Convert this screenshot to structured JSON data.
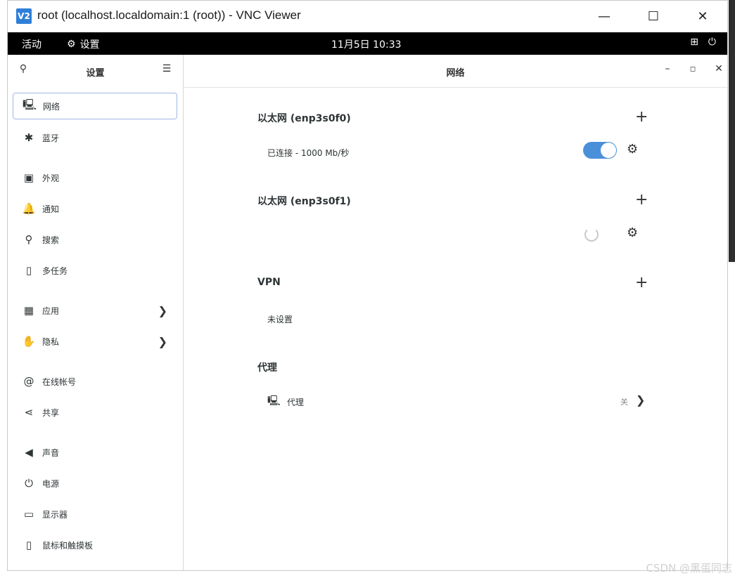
{
  "window": {
    "title": "root (localhost.localdomain:1 (root)) - VNC Viewer",
    "logo": "V2",
    "minimize": "—",
    "maximize": "☐",
    "close": "✕"
  },
  "topbar": {
    "activities": "活动",
    "app_menu": "设置",
    "clock": "11月5日  10:33"
  },
  "sidebar": {
    "title": "设置",
    "items": [
      {
        "label": "网络",
        "icon": "network-icon",
        "glyph": "🖳",
        "chevron": false
      },
      {
        "label": "蓝牙",
        "icon": "bluetooth-icon",
        "glyph": "✱",
        "chevron": false
      },
      {
        "label": "外观",
        "icon": "appearance-icon",
        "glyph": "▣",
        "chevron": false
      },
      {
        "label": "通知",
        "icon": "bell-icon",
        "glyph": "🔔",
        "chevron": false
      },
      {
        "label": "搜索",
        "icon": "search-icon",
        "glyph": "⚲",
        "chevron": false
      },
      {
        "label": "多任务",
        "icon": "multitask-icon",
        "glyph": "▯",
        "chevron": false
      },
      {
        "label": "应用",
        "icon": "apps-icon",
        "glyph": "▦",
        "chevron": true
      },
      {
        "label": "隐私",
        "icon": "hand-icon",
        "glyph": "✋",
        "chevron": true
      },
      {
        "label": "在线帐号",
        "icon": "at-icon",
        "glyph": "@",
        "chevron": false
      },
      {
        "label": "共享",
        "icon": "share-icon",
        "glyph": "⋖",
        "chevron": false
      },
      {
        "label": "声音",
        "icon": "speaker-icon",
        "glyph": "◀",
        "chevron": false
      },
      {
        "label": "电源",
        "icon": "power-plug-icon",
        "glyph": "⏻",
        "chevron": false
      },
      {
        "label": "显示器",
        "icon": "display-icon",
        "glyph": "▭",
        "chevron": false
      },
      {
        "label": "鼠标和触摸板",
        "icon": "mouse-icon",
        "glyph": "▯",
        "chevron": false
      }
    ]
  },
  "main": {
    "title": "网络",
    "ethernet0": {
      "title": "以太网 (enp3s0f0)",
      "status": "已连接 - 1000 Mb/秒",
      "enabled": true
    },
    "ethernet1": {
      "title": "以太网 (enp3s0f1)"
    },
    "vpn": {
      "title": "VPN",
      "status": "未设置"
    },
    "proxy": {
      "title": "代理",
      "row_label": "代理",
      "row_value": "关"
    }
  },
  "watermark": "CSDN @黑蛋同志"
}
